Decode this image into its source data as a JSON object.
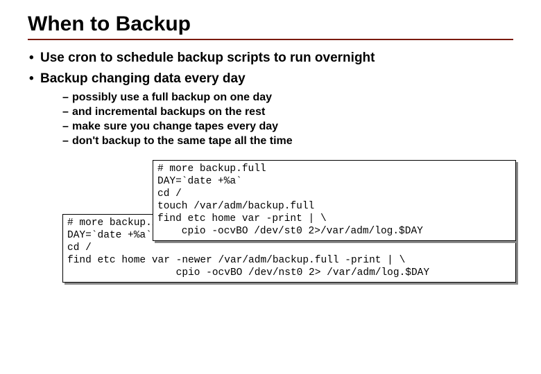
{
  "title": "When to Backup",
  "bullets": {
    "b0": "Use cron to schedule backup scripts to run overnight",
    "b1": "Backup changing data every day"
  },
  "sub": {
    "s0": "possibly use a full backup on one day",
    "s1": "and incremental backups on the rest",
    "s2": "make sure you change tapes every day",
    "s3": "don't backup to the same tape all the time"
  },
  "code": {
    "full": "# more backup.full\nDAY=`date +%a`\ncd /\ntouch /var/adm/backup.full\nfind etc home var -print | \\\n    cpio -ocvBO /dev/st0 2>/var/adm/log.$DAY",
    "inc": "# more backup.inc\nDAY=`date +%a`\ncd /\nfind etc home var -newer /var/adm/backup.full -print | \\\n                  cpio -ocvBO /dev/nst0 2> /var/adm/log.$DAY"
  }
}
